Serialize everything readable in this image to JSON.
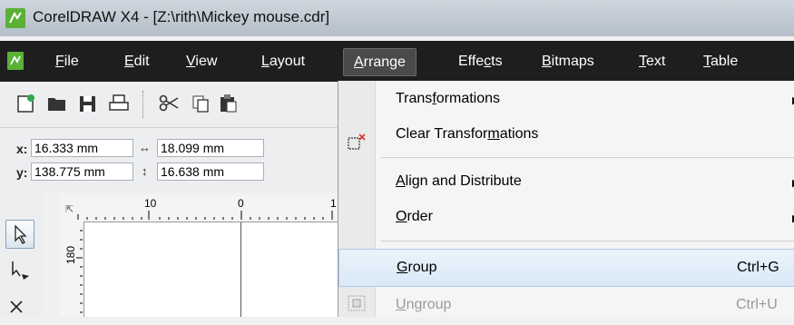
{
  "window": {
    "title": "CorelDRAW X4 - [Z:\\rith\\Mickey mouse.cdr]"
  },
  "menubar": {
    "items": [
      {
        "label": "File",
        "ul": "F"
      },
      {
        "label": "Edit",
        "ul": "E"
      },
      {
        "label": "View",
        "ul": "V"
      },
      {
        "label": "Layout",
        "ul": "L"
      },
      {
        "label": "Arrange",
        "ul": "A",
        "active": true
      },
      {
        "label": "Effects",
        "ul": "c"
      },
      {
        "label": "Bitmaps",
        "ul": "B"
      },
      {
        "label": "Text",
        "ul": "T"
      },
      {
        "label": "Table",
        "ul": "T"
      }
    ]
  },
  "toolbar": {
    "icons": [
      "new-document-icon",
      "open-folder-icon",
      "save-icon",
      "print-icon",
      "cut-icon",
      "copy-icon",
      "paste-icon"
    ]
  },
  "properties": {
    "x_label": "x:",
    "x_value": "16.333 mm",
    "y_label": "y:",
    "y_value": "138.775 mm",
    "w_value": "18.099 mm",
    "h_value": "16.638 mm"
  },
  "rulers": {
    "h_ticks": [
      "10",
      "0",
      "1"
    ],
    "v_tick": "180"
  },
  "arrange_menu": {
    "items": [
      {
        "label": "Transformations",
        "shortcut": "",
        "submenu": true,
        "disabled": false
      },
      {
        "label": "Clear Transformations",
        "shortcut": "",
        "submenu": false,
        "disabled": false
      },
      {
        "label": "Align and Distribute",
        "shortcut": "",
        "submenu": true,
        "disabled": false
      },
      {
        "label": "Order",
        "shortcut": "",
        "submenu": true,
        "disabled": false
      },
      {
        "label": "Group",
        "shortcut": "Ctrl+G",
        "submenu": false,
        "disabled": false,
        "hover": true
      },
      {
        "label": "Ungroup",
        "shortcut": "Ctrl+U",
        "submenu": false,
        "disabled": true
      }
    ]
  },
  "colors": {
    "menubar_bg": "#1e1e1e",
    "hover_bg": "#d9e9f7",
    "disabled_text": "#9a9a9a"
  }
}
